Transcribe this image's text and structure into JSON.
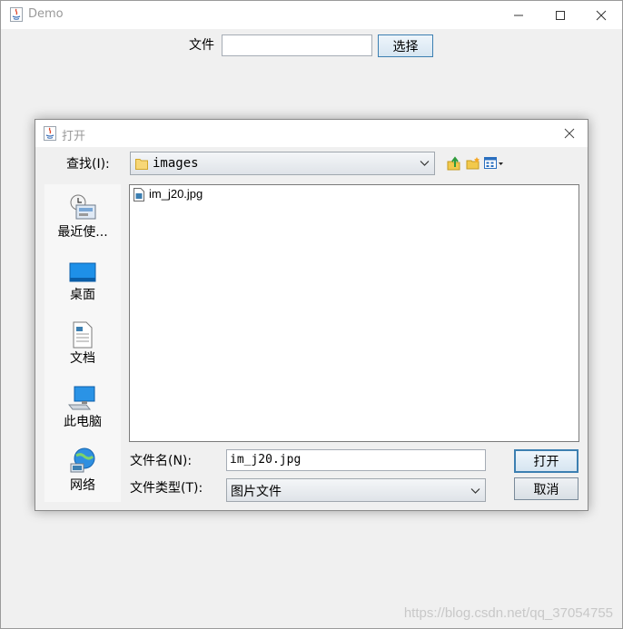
{
  "window": {
    "title": "Demo"
  },
  "main": {
    "file_label": "文件",
    "file_value": "",
    "choose_button": "选择"
  },
  "dialog": {
    "title": "打开",
    "lookin_label": "查找(I):",
    "lookin_value": "images",
    "places": [
      {
        "label": "最近使...",
        "icon": "recent-icon"
      },
      {
        "label": "桌面",
        "icon": "desktop-icon"
      },
      {
        "label": "文档",
        "icon": "documents-icon"
      },
      {
        "label": "此电脑",
        "icon": "computer-icon"
      },
      {
        "label": "网络",
        "icon": "network-icon"
      }
    ],
    "files": [
      {
        "name": "im_j20.jpg",
        "icon": "image-file-icon"
      }
    ],
    "filename_label": "文件名(N):",
    "filename_value": "im_j20.jpg",
    "filetype_label": "文件类型(T):",
    "filetype_value": "图片文件",
    "open_button": "打开",
    "cancel_button": "取消"
  },
  "watermark": "https://blog.csdn.net/qq_37054755",
  "colors": {
    "accent_blue": "#3c7fb1",
    "folder_yellow": "#f2c94c",
    "button_border": "#7a8a99"
  }
}
